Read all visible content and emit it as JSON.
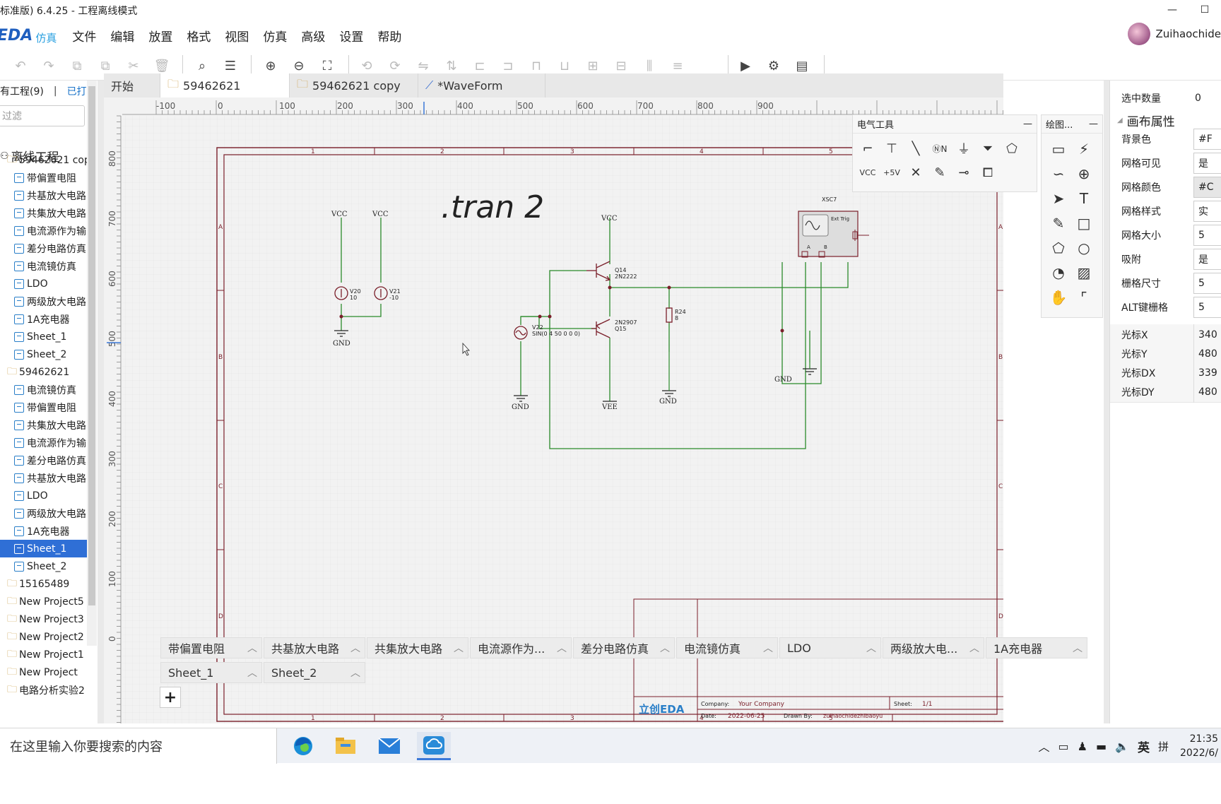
{
  "window": {
    "title": "标准版) 6.4.25 - 工程离线模式",
    "minimize": "—",
    "maximize": "☐"
  },
  "app": {
    "logo": "EDA",
    "logo_sub": "仿真",
    "username": "Zuihaochide"
  },
  "menu": [
    "文件",
    "编辑",
    "放置",
    "格式",
    "视图",
    "仿真",
    "高级",
    "设置",
    "帮助"
  ],
  "left": {
    "tab_all": "有工程(9)",
    "tab_open": "已打",
    "filter_placeholder": "过滤",
    "root": "离线工程",
    "tree": [
      {
        "label": "59462621 copy",
        "type": "folder",
        "indent": 1
      },
      {
        "label": "带偏置电阻",
        "type": "sheet",
        "indent": 2
      },
      {
        "label": "共基放大电路",
        "type": "sheet",
        "indent": 2
      },
      {
        "label": "共集放大电路",
        "type": "sheet",
        "indent": 2
      },
      {
        "label": "电流源作为输",
        "type": "sheet",
        "indent": 2
      },
      {
        "label": "差分电路仿真",
        "type": "sheet",
        "indent": 2
      },
      {
        "label": "电流镜仿真",
        "type": "sheet",
        "indent": 2
      },
      {
        "label": "LDO",
        "type": "sheet",
        "indent": 2
      },
      {
        "label": "两级放大电路",
        "type": "sheet",
        "indent": 2
      },
      {
        "label": "1A充电器",
        "type": "sheet",
        "indent": 2
      },
      {
        "label": "Sheet_1",
        "type": "sheet",
        "indent": 2
      },
      {
        "label": "Sheet_2",
        "type": "sheet",
        "indent": 2
      },
      {
        "label": "59462621",
        "type": "folder",
        "indent": 1
      },
      {
        "label": "电流镜仿真",
        "type": "sheet",
        "indent": 2
      },
      {
        "label": "带偏置电阻",
        "type": "sheet",
        "indent": 2
      },
      {
        "label": "共集放大电路",
        "type": "sheet",
        "indent": 2
      },
      {
        "label": "电流源作为输",
        "type": "sheet",
        "indent": 2
      },
      {
        "label": "差分电路仿真",
        "type": "sheet",
        "indent": 2
      },
      {
        "label": "共基放大电路",
        "type": "sheet",
        "indent": 2
      },
      {
        "label": "LDO",
        "type": "sheet",
        "indent": 2
      },
      {
        "label": "两级放大电路",
        "type": "sheet",
        "indent": 2
      },
      {
        "label": "1A充电器",
        "type": "sheet",
        "indent": 2
      },
      {
        "label": "Sheet_1",
        "type": "sheet",
        "indent": 2,
        "selected": true
      },
      {
        "label": "Sheet_2",
        "type": "sheet",
        "indent": 2
      },
      {
        "label": "15165489",
        "type": "folder",
        "indent": 1
      },
      {
        "label": "New Project5",
        "type": "folder",
        "indent": 1
      },
      {
        "label": "New Project3",
        "type": "folder",
        "indent": 1
      },
      {
        "label": "New Project2",
        "type": "folder",
        "indent": 1
      },
      {
        "label": "New Project1",
        "type": "folder",
        "indent": 1
      },
      {
        "label": "New Project",
        "type": "folder",
        "indent": 1
      },
      {
        "label": "电路分析实验2",
        "type": "folder",
        "indent": 1
      }
    ]
  },
  "tabs": [
    "开始",
    "59462621",
    "59462621 copy",
    "*WaveForm"
  ],
  "ruler": {
    "top": [
      "-100",
      "0",
      "100",
      "200",
      "300",
      "400",
      "500",
      "600",
      "700",
      "800",
      "900"
    ],
    "left": [
      "800",
      "700",
      "600",
      "500",
      "400",
      "300",
      "200",
      "100",
      "0"
    ]
  },
  "schematic": {
    "directive": ".tran 2",
    "cols": [
      "1",
      "2",
      "3",
      "4",
      "5"
    ],
    "rows": [
      "A",
      "B",
      "C",
      "D"
    ],
    "vcc": "VCC",
    "gnd": "GND",
    "vee": "VEE",
    "v20": "V20",
    "v20_val": "10",
    "v21": "V21",
    "v21_val": "-10",
    "v22": "V22",
    "v22_val": "SIN(0 4 50 0 0 0)",
    "q14": "Q14",
    "q14_part": "2N2222",
    "q15": "Q15",
    "q15_part": "2N2907",
    "r24": "R24",
    "r24_val": "8",
    "scope": "XSC7",
    "ext_trig": "Ext Trig",
    "ch_a": "A",
    "ch_b": "B",
    "tb_logo": "立创EDA",
    "tb_company_label": "Company:",
    "tb_company": "Your Company",
    "tb_sheet_label": "Sheet:",
    "tb_sheet": "1/1",
    "tb_date_label": "Date:",
    "tb_date": "2022-06-25",
    "tb_drawn_label": "Drawn By:",
    "tb_drawn": "zuihaochidezhibaoyu"
  },
  "eleTools": {
    "title": "电气工具",
    "close": "—"
  },
  "drawTools": {
    "title": "绘图...",
    "close": "—"
  },
  "sheetTabs": [
    "带偏置电阻",
    "共基放大电路",
    "共集放大电路",
    "电流源作为...",
    "差分电路仿真",
    "电流镜仿真",
    "LDO",
    "两级放大电...",
    "1A充电器",
    "Sheet_1",
    "Sheet_2"
  ],
  "addSheet": "+",
  "right": {
    "selected_label": "选中数量",
    "selected_value": "0",
    "section": "画布属性",
    "props": [
      {
        "k": "背景色",
        "v": "#F"
      },
      {
        "k": "网格可见",
        "v": "是"
      },
      {
        "k": "网格颜色",
        "v": "#C"
      },
      {
        "k": "网格样式",
        "v": "实"
      },
      {
        "k": "网格大小",
        "v": "5"
      },
      {
        "k": "吸附",
        "v": "是"
      },
      {
        "k": "栅格尺寸",
        "v": "5"
      },
      {
        "k": "ALT键栅格",
        "v": "5"
      }
    ],
    "cursor": [
      {
        "k": "光标X",
        "v": "340"
      },
      {
        "k": "光标Y",
        "v": "480"
      },
      {
        "k": "光标DX",
        "v": "339"
      },
      {
        "k": "光标DY",
        "v": "480"
      }
    ]
  },
  "taskbar": {
    "search": "在这里输入你要搜索的内容",
    "ime": "英",
    "ime2": "拼",
    "time": "21:35",
    "date": "2022/6/"
  }
}
